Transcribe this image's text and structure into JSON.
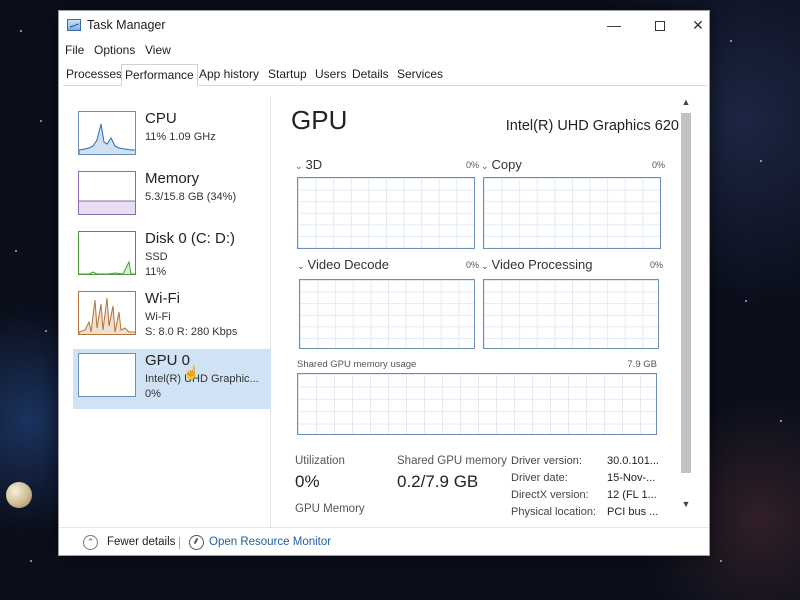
{
  "window": {
    "title": "Task Manager"
  },
  "menu": [
    "File",
    "Options",
    "View"
  ],
  "tabs": [
    "Processes",
    "Performance",
    "App history",
    "Startup",
    "Users",
    "Details",
    "Services"
  ],
  "active_tab": "Performance",
  "resources": [
    {
      "name": "CPU",
      "sub1": "11% 1.09 GHz",
      "sub2": ""
    },
    {
      "name": "Memory",
      "sub1": "5.3/15.8 GB (34%)",
      "sub2": ""
    },
    {
      "name": "Disk 0 (C: D:)",
      "sub1": "SSD",
      "sub2": "11%"
    },
    {
      "name": "Wi-Fi",
      "sub1": "Wi-Fi",
      "sub2": "S: 8.0  R: 280 Kbps"
    },
    {
      "name": "GPU 0",
      "sub1": "Intel(R) UHD Graphic...",
      "sub2": "0%"
    }
  ],
  "selected_resource": "GPU 0",
  "gpu": {
    "title": "GPU",
    "model": "Intel(R) UHD Graphics 620",
    "engines": [
      {
        "label": "3D",
        "pct": "0%"
      },
      {
        "label": "Copy",
        "pct": "0%"
      },
      {
        "label": "Video Decode",
        "pct": "0%"
      },
      {
        "label": "Video Processing",
        "pct": "0%"
      }
    ],
    "shared_mem": {
      "label": "Shared GPU memory usage",
      "max": "7.9 GB"
    },
    "stats": {
      "utilization_label": "Utilization",
      "utilization_value": "0%",
      "shared_label": "Shared GPU memory",
      "shared_value": "0.2/7.9 GB",
      "gpu_memory_label": "GPU Memory"
    },
    "driver": [
      {
        "label": "Driver version:",
        "value": "30.0.101..."
      },
      {
        "label": "Driver date:",
        "value": "15-Nov-..."
      },
      {
        "label": "DirectX version:",
        "value": "12 (FL 1..."
      },
      {
        "label": "Physical location:",
        "value": "PCI bus ..."
      }
    ]
  },
  "footer": {
    "fewer_details": "Fewer details",
    "resource_monitor": "Open Resource Monitor"
  },
  "colors": {
    "accent": "#1d5fa6",
    "selected_bg": "#cfe3f5",
    "graph_border": "#6b8fb8"
  },
  "icons": [
    "task-manager-icon",
    "minimize-icon",
    "maximize-icon",
    "close-icon",
    "chevron-up-circle-icon",
    "resource-monitor-icon",
    "scroll-up-icon",
    "scroll-down-icon",
    "mouse-cursor-icon"
  ]
}
